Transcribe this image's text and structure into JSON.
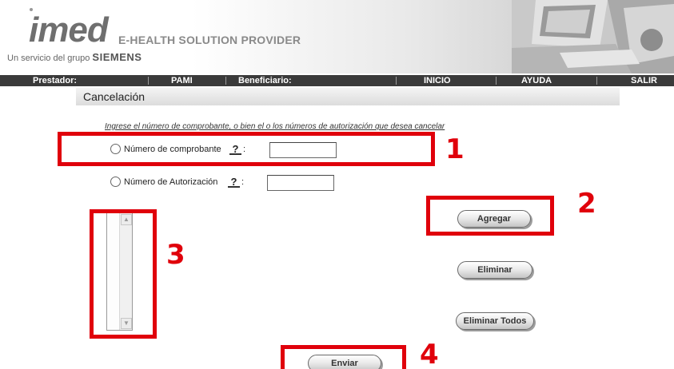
{
  "header": {
    "logo_text": "imed",
    "tagline": "E-HEALTH SOLUTION PROVIDER",
    "subline_prefix": "Un servicio del grupo",
    "subline_brand": "SIEMENS"
  },
  "nav": {
    "prestador": "Prestador:",
    "pami": "PAMI",
    "beneficiario": "Beneficiario:",
    "inicio": "INICIO",
    "ayuda": "AYUDA",
    "salir": "SALIR"
  },
  "page": {
    "title": "Cancelación",
    "instructions": "Ingrese el número de comprobante, o bien el o los números de autorización que desea cancelar"
  },
  "form": {
    "comprobante_label": "Número de comprobante",
    "autorizacion_label": "Número de Autorización",
    "help_glyph": "?",
    "colon": ":",
    "comprobante_value": "",
    "autorizacion_value": ""
  },
  "buttons": {
    "agregar": "Agregar",
    "eliminar": "Eliminar",
    "eliminar_todos": "Eliminar Todos",
    "enviar": "Enviar"
  },
  "annotations": {
    "labels": [
      "1",
      "2",
      "3",
      "4"
    ],
    "color": "#e0000b"
  },
  "icons": {
    "scroll_up": "▲",
    "scroll_down": "▼"
  }
}
